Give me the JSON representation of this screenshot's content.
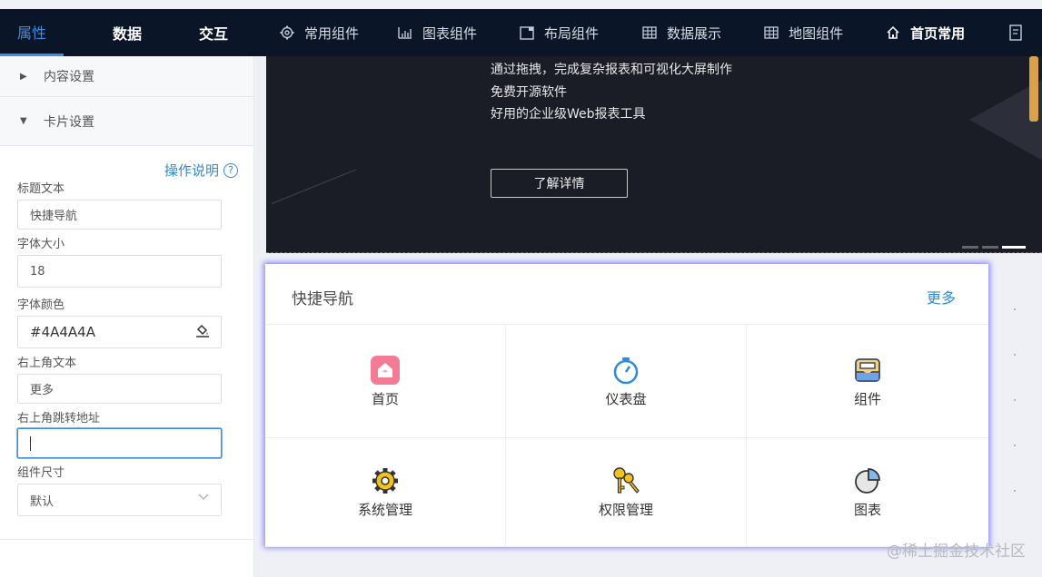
{
  "topbar": {
    "tabs": [
      {
        "label": "属性",
        "active": true
      },
      {
        "label": "数据",
        "active": false
      },
      {
        "label": "交互",
        "active": false
      }
    ],
    "groups": [
      {
        "label": "常用组件",
        "icon": "gear-icon"
      },
      {
        "label": "图表组件",
        "icon": "bar-chart-icon"
      },
      {
        "label": "布局组件",
        "icon": "layout-icon"
      },
      {
        "label": "数据展示",
        "icon": "table-icon"
      },
      {
        "label": "地图组件",
        "icon": "map-grid-icon"
      },
      {
        "label": "首页常用",
        "icon": "home-icon"
      }
    ]
  },
  "panel": {
    "sections": [
      {
        "label": "内容设置",
        "expanded": false
      },
      {
        "label": "卡片设置",
        "expanded": true
      }
    ],
    "help_label": "操作说明",
    "fields": {
      "title_label": "标题文本",
      "title_value": "快捷导航",
      "font_size_label": "字体大小",
      "font_size_value": "18",
      "font_color_label": "字体颜色",
      "font_color_value": "#4A4A4A",
      "corner_text_label": "右上角文本",
      "corner_text_value": "更多",
      "corner_link_label": "右上角跳转地址",
      "corner_link_value": "",
      "size_label": "组件尺寸",
      "size_value": "默认"
    }
  },
  "banner": {
    "lines": [
      "通过拖拽，完成复杂报表和可视化大屏制作",
      "免费开源软件",
      "好用的企业级Web报表工具"
    ],
    "button_label": "了解详情"
  },
  "card": {
    "title": "快捷导航",
    "more_label": "更多",
    "title_color": "#4A4A4A",
    "items": [
      {
        "label": "首页",
        "icon": "home-icon"
      },
      {
        "label": "仪表盘",
        "icon": "stopwatch-icon"
      },
      {
        "label": "组件",
        "icon": "inbox-icon"
      },
      {
        "label": "系统管理",
        "icon": "gear-icon"
      },
      {
        "label": "权限管理",
        "icon": "keys-icon"
      },
      {
        "label": "图表",
        "icon": "pie-chart-icon"
      }
    ]
  },
  "watermark": "@稀土掘金技术社区"
}
